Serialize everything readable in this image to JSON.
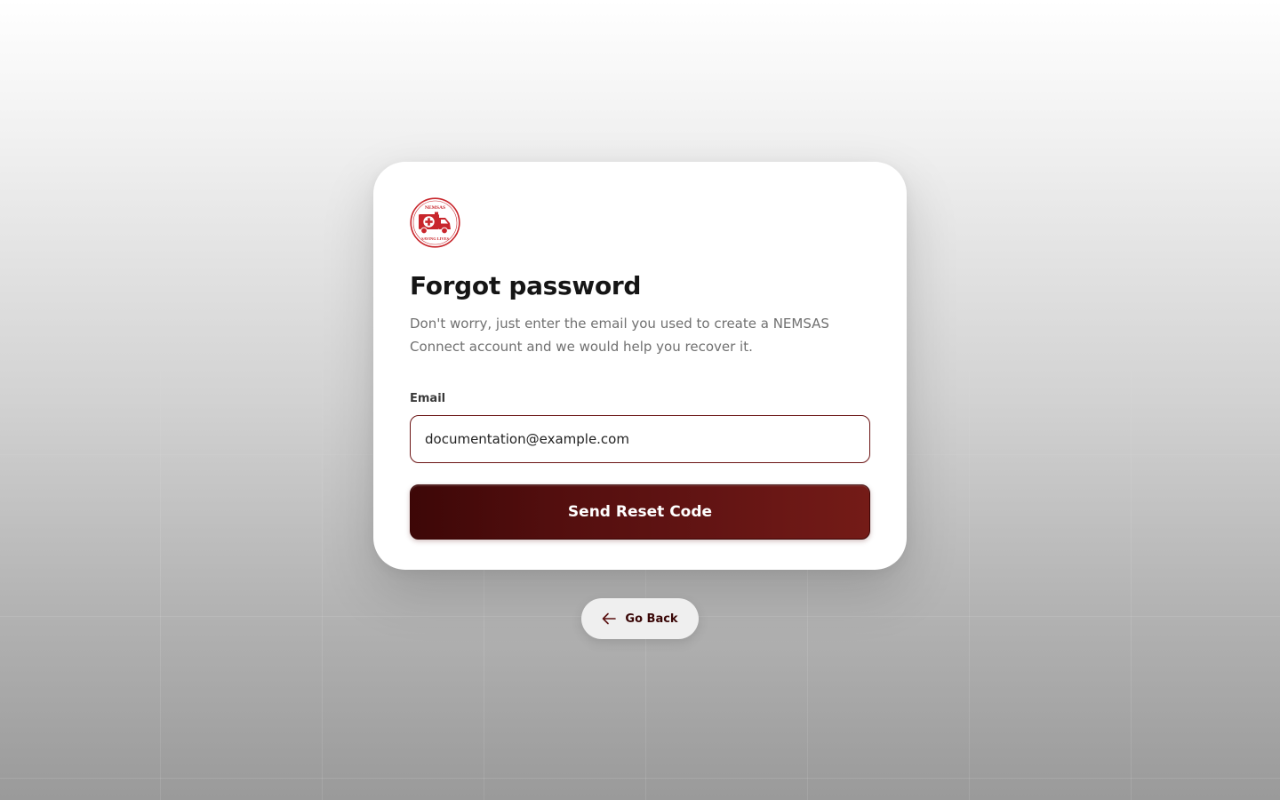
{
  "logo": {
    "icon": "ambulance-logo-icon",
    "top_text": "NEMSAS",
    "bottom_text": "SAVING LIVES",
    "color": "#c8262c"
  },
  "card": {
    "title": "Forgot password",
    "subtitle": "Don't worry, just enter the email you used to create a NEMSAS Connect account and we would help you recover it."
  },
  "form": {
    "email_label": "Email",
    "email_value": "documentation@example.com",
    "submit_label": "Send Reset Code"
  },
  "nav": {
    "back_label": "Go Back",
    "back_icon": "arrow-left-icon"
  },
  "colors": {
    "brand_dark": "#3d0707",
    "brand": "#741b17",
    "logo_red": "#c8262c"
  }
}
